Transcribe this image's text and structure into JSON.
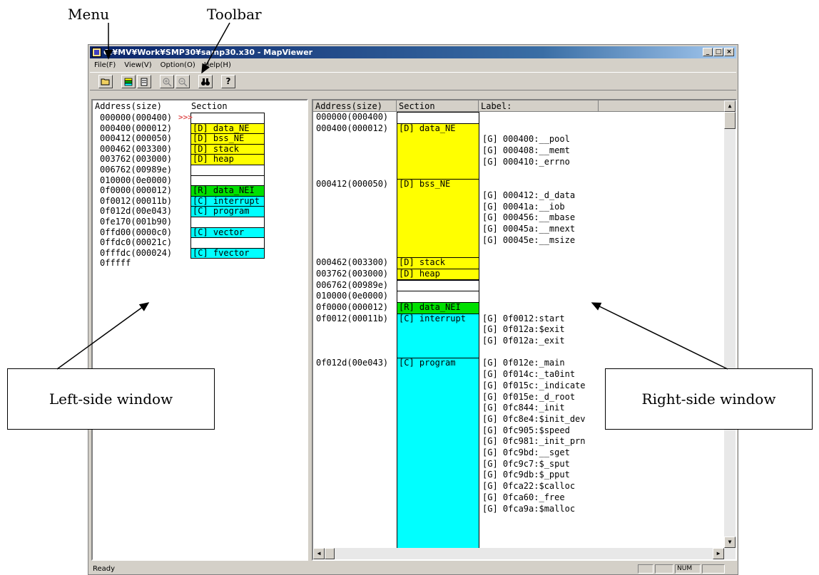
{
  "annotations": {
    "menu": "Menu",
    "toolbar": "Toolbar",
    "left_window": "Left-side window",
    "right_window": "Right-side window"
  },
  "window": {
    "title": "C:¥MV¥Work¥SMP30¥samp30.x30 - MapViewer"
  },
  "menu": [
    "File(F)",
    "View(V)",
    "Option(O)",
    "Help(H)"
  ],
  "toolbar": {
    "icons": [
      "open-folder-icon",
      "memory-map-view-icon",
      "list-view-icon",
      "zoom-in-icon",
      "zoom-out-icon",
      "find-binoculars-icon",
      "help-icon"
    ]
  },
  "colors": {
    "data": "#ffff00",
    "rom": "#00e000",
    "code": "#00ffff",
    "empty": "#ffffff"
  },
  "left": {
    "headers": {
      "address": "Address(size)",
      "section": "Section"
    },
    "rows": [
      {
        "addr": "000000(000400)",
        "section": "",
        "kind": "empty"
      },
      {
        "addr": "000400(000012)",
        "section": "[D] data_NE",
        "kind": "data"
      },
      {
        "addr": "000412(000050)",
        "section": "[D] bss_NE",
        "kind": "data"
      },
      {
        "addr": "000462(003300)",
        "section": "[D] stack",
        "kind": "data"
      },
      {
        "addr": "003762(003000)",
        "section": "[D] heap",
        "kind": "data"
      },
      {
        "addr": "006762(00989e)",
        "section": "",
        "kind": "empty"
      },
      {
        "addr": "010000(0e0000)",
        "section": "",
        "kind": "empty"
      },
      {
        "addr": "0f0000(000012)",
        "section": "[R] data_NEI",
        "kind": "rom"
      },
      {
        "addr": "0f0012(00011b)",
        "section": "[C] interrupt",
        "kind": "code"
      },
      {
        "addr": "0f012d(00e043)",
        "section": "[C] program",
        "kind": "code"
      },
      {
        "addr": "0fe170(001b90)",
        "section": "",
        "kind": "empty"
      },
      {
        "addr": "0ffd00(0000c0)",
        "section": "[C] vector",
        "kind": "code"
      },
      {
        "addr": "0ffdc0(00021c)",
        "section": "",
        "kind": "empty"
      },
      {
        "addr": "0fffdc(000024)",
        "section": "[C] fvector",
        "kind": "code"
      }
    ],
    "end_addr": "0fffff",
    "marker": ">>>"
  },
  "right": {
    "headers": {
      "address": "Address(size)",
      "section": "Section",
      "label": "Label:"
    },
    "rows": [
      {
        "addr": "000000(000400)",
        "section": "",
        "kind": "empty",
        "lines": 1,
        "labels": []
      },
      {
        "addr": "000400(000012)",
        "section": "[D] data_NE",
        "kind": "data",
        "lines": 5,
        "labels": [
          "[G] 000400:__pool",
          "[G] 000408:__memt",
          "[G] 000410:_errno"
        ]
      },
      {
        "addr": "000412(000050)",
        "section": "[D] bss_NE",
        "kind": "data",
        "lines": 7,
        "labels": [
          "[G] 000412:_d_data",
          "[G] 00041a:__iob",
          "[G] 000456:__mbase",
          "[G] 00045a:__mnext",
          "[G] 00045e:__msize"
        ]
      },
      {
        "addr": "000462(003300)",
        "section": "[D] stack",
        "kind": "data",
        "lines": 1,
        "labels": []
      },
      {
        "addr": "003762(003000)",
        "section": "[D] heap",
        "kind": "data",
        "lines": 1,
        "labels": []
      },
      {
        "addr": "006762(00989e)",
        "section": "",
        "kind": "empty",
        "lines": 1,
        "labels": []
      },
      {
        "addr": "010000(0e0000)",
        "section": "",
        "kind": "empty",
        "lines": 1,
        "labels": []
      },
      {
        "addr": "0f0000(000012)",
        "section": "[R] data_NEI",
        "kind": "rom",
        "lines": 1,
        "labels": []
      },
      {
        "addr": "0f0012(00011b)",
        "section": "[C] interrupt",
        "kind": "code",
        "lines": 4,
        "labels": [
          "[G] 0f0012:start",
          "[G] 0f012a:$exit",
          "[G] 0f012a:_exit"
        ]
      },
      {
        "addr": "0f012d(00e043)",
        "section": "[C] program",
        "kind": "code",
        "lines": 17,
        "labels": [
          "[G] 0f012e:_main",
          "[G] 0f014c:_ta0int",
          "[G] 0f015c:_indicate",
          "[G] 0f015e:_d_root",
          "[G] 0fc844:_init",
          "[G] 0fc8e4:$init_dev",
          "[G] 0fc905:$speed",
          "[G] 0fc981:_init_prn",
          "[G] 0fc9bd:__sget",
          "[G] 0fc9c7:$_sput",
          "[G] 0fc9db:$_pput",
          "[G] 0fca22:$calloc",
          "[G] 0fca60:_free",
          "[G] 0fca9a:$malloc"
        ]
      }
    ]
  },
  "status": {
    "text": "Ready",
    "num": "NUM"
  }
}
